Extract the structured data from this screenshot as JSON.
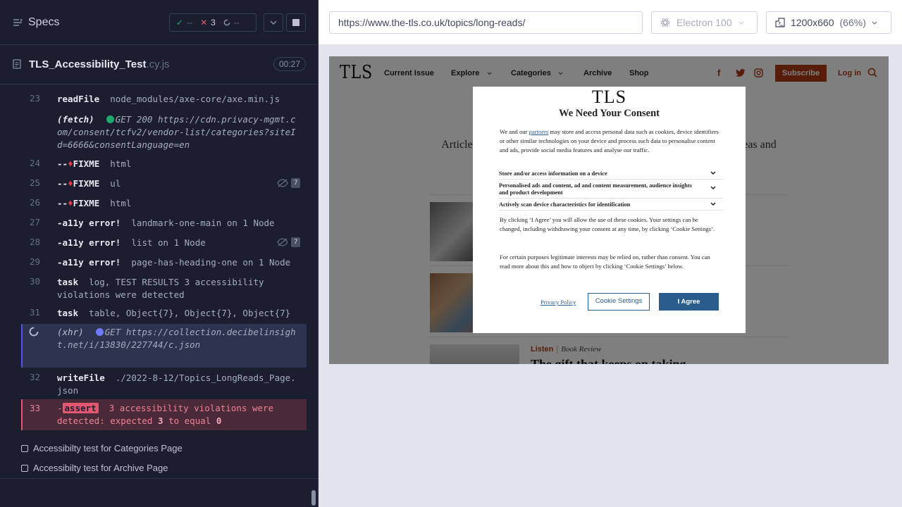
{
  "reporter": {
    "header_title": "Specs",
    "stats": {
      "passed": "--",
      "failed": "3",
      "pending": "--"
    },
    "spec_name": "TLS_Accessibility_Test",
    "spec_ext": ".cy.js",
    "duration": "00:27",
    "commands": [
      {
        "num": "23",
        "name": "readFile",
        "msg": "node_modules/axe-core/axe.min.js"
      },
      {
        "num": "",
        "name": "(fetch)",
        "method": "GET 200",
        "msg": "https://cdn.privacy-mgmt.com/consent/tcfv2/vendor-list/categories?siteId=6666&consentLanguage=en"
      },
      {
        "num": "24",
        "prefix": "--",
        "name": "FIXME",
        "msg": "html"
      },
      {
        "num": "25",
        "prefix": "--",
        "name": "FIXME",
        "msg": "ul",
        "badge": "7"
      },
      {
        "num": "26",
        "prefix": "--",
        "name": "FIXME",
        "msg": "html"
      },
      {
        "num": "27",
        "prefix": "-",
        "name": "a11y error!",
        "msg": "landmark-one-main on 1 Node"
      },
      {
        "num": "28",
        "prefix": "-",
        "name": "a11y error!",
        "msg": "list on 1 Node",
        "badge": "7"
      },
      {
        "num": "29",
        "prefix": "-",
        "name": "a11y error!",
        "msg": "page-has-heading-one on 1 Node"
      },
      {
        "num": "30",
        "name": "task",
        "msg": "log, TEST RESULTS 3 accessibility violations were detected"
      },
      {
        "num": "31",
        "name": "task",
        "msg": "table, Object{7}, Object{7}, Object{7}"
      },
      {
        "num": "",
        "name": "(xhr)",
        "method": "GET",
        "msg": "https://collection.decibelinsight.net/i/13830/227744/c.json"
      },
      {
        "num": "32",
        "name": "writeFile",
        "msg": "./2022-8-12/Topics_LongReads_Page.json"
      }
    ],
    "assert": {
      "num": "33",
      "prefix": "-",
      "label": "assert",
      "msg_a": "3 accessibility violations were",
      "msg_b": "detected: expected",
      "expected": "3",
      "msg_c": "to equal",
      "actual": "0"
    },
    "tests": [
      "Accessibilty test for Categories Page",
      "Accessibilty test for Archive Page"
    ]
  },
  "browser": {
    "url": "https://www.the-tls.co.uk/topics/long-reads/",
    "browser_name": "Electron 100",
    "viewport": "1200x660",
    "zoom": "(66%)"
  },
  "site": {
    "logo": "TLS",
    "nav": [
      "Current Issue",
      "Explore",
      "Categories",
      "Archive",
      "Shop"
    ],
    "subscribe": "Subscribe",
    "login": "Log in",
    "tagline_left": "Articles worth m",
    "tagline_right": "th new ideas and",
    "article": {
      "tag": "Listen",
      "sep": "|",
      "type": "Book Review",
      "headline": "The gift that keeps on taking"
    }
  },
  "consent": {
    "logo": "TLS",
    "title": "We Need Your Consent",
    "intro_a": "We and our ",
    "intro_link": "partners",
    "intro_b": " may store and access personal data such as cookies, device identifiers or other similar technologies on your device and process such data to personalise content and ads, provide social media features and analyse our traffic.",
    "purposes": [
      "Store and/or access information on a device",
      "Personalised ads and content, ad and content measurement, audience insights and product development",
      "Actively scan device characteristics for identification"
    ],
    "para2": "By clicking ‘I Agree’ you will allow the use of these cookies. Your settings can be changed, including withdrawing your consent at any time, by clicking ‘Cookie Settings’.",
    "para3": "For certain purposes legitimate interests may be relied on, rather than consent. You can read more about this and how to object by clicking ‘Cookie Settings’ below.",
    "privacy_link": "Privacy Policy",
    "settings_btn": "Cookie Settings",
    "agree_btn": "I Agree"
  },
  "colors": {
    "reporter_bg": "#1b1e2e",
    "failed": "#e45770",
    "running": "#4956e3",
    "tls_brand": "#b13b14",
    "consent_blue": "#2a5d8c"
  }
}
